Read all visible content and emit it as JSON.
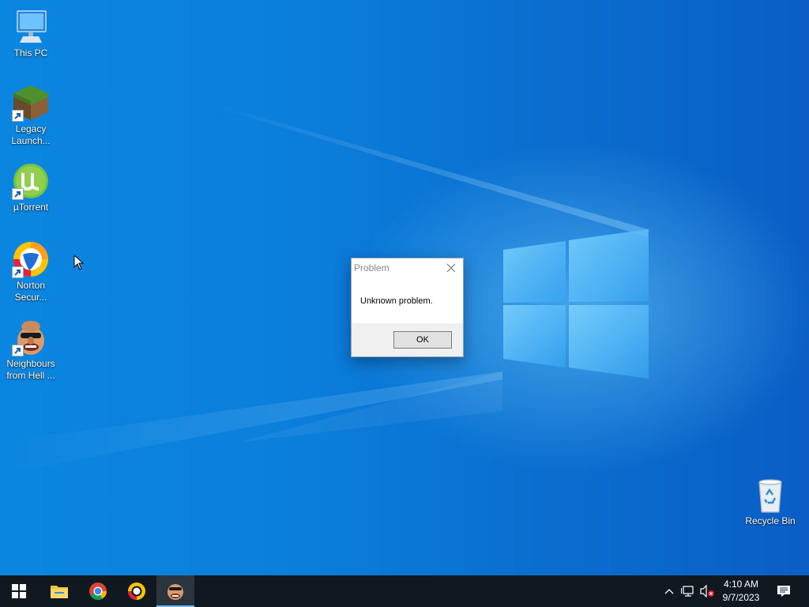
{
  "desktop": {
    "icons": [
      {
        "label": "This PC",
        "icon": "this-pc-icon"
      },
      {
        "label": "Legacy Launch...",
        "icon": "minecraft-grass-block-icon"
      },
      {
        "label": "µTorrent",
        "icon": "utorrent-icon"
      },
      {
        "label": "Norton Secur...",
        "icon": "norton-icon"
      },
      {
        "label": "Neighbours from Hell ...",
        "icon": "neighbours-from-hell-icon"
      },
      {
        "label": "Recycle Bin",
        "icon": "recycle-bin-icon"
      }
    ]
  },
  "dialog": {
    "title": "Problem",
    "message": "Unknown problem.",
    "ok_label": "OK"
  },
  "taskbar": {
    "apps": [
      {
        "name": "start",
        "icon": "windows-start-icon"
      },
      {
        "name": "file-explorer",
        "icon": "folder-icon"
      },
      {
        "name": "chrome",
        "icon": "chrome-icon"
      },
      {
        "name": "norton",
        "icon": "norton-icon"
      },
      {
        "name": "neighbours-from-hell",
        "icon": "neighbours-from-hell-icon",
        "active": true
      }
    ],
    "tray_icons": [
      "chevron-up-icon",
      "network-icon",
      "volume-muted-icon",
      "notification-icon"
    ],
    "time": "4:10 AM",
    "date": "9/7/2023"
  },
  "colors": {
    "wallpaper": "#0a78d7",
    "taskbar": "#101820",
    "accent": "#76b9ed"
  }
}
